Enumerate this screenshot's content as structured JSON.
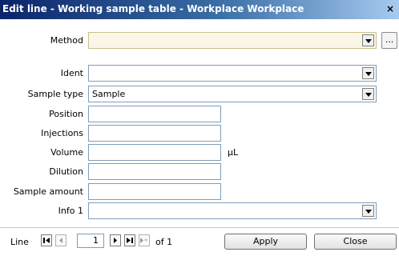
{
  "window": {
    "title": "Edit line - Working sample table - Workplace Workplace",
    "close_label": "×"
  },
  "form": {
    "method": {
      "label": "Method",
      "value": "",
      "browse_label": "..."
    },
    "ident": {
      "label": "Ident",
      "value": ""
    },
    "sample_type": {
      "label": "Sample type",
      "value": "Sample"
    },
    "position": {
      "label": "Position",
      "value": ""
    },
    "injections": {
      "label": "Injections",
      "value": ""
    },
    "volume": {
      "label": "Volume",
      "value": "",
      "unit": "µL"
    },
    "dilution": {
      "label": "Dilution",
      "value": ""
    },
    "sample_amount": {
      "label": "Sample amount",
      "value": ""
    },
    "info1": {
      "label": "Info 1",
      "value": ""
    }
  },
  "footer": {
    "line_label": "Line",
    "current": "1",
    "of_text": "of 1",
    "apply_label": "Apply",
    "close_label": "Close"
  },
  "icons": [
    "close-icon",
    "chevron-down-icon",
    "first-record-icon",
    "previous-record-icon",
    "next-record-icon",
    "last-record-icon",
    "new-record-icon"
  ],
  "colors": {
    "title_start": "#0a246a",
    "title_end": "#a6caf0",
    "method_field_bg": "#fbf7e8"
  }
}
